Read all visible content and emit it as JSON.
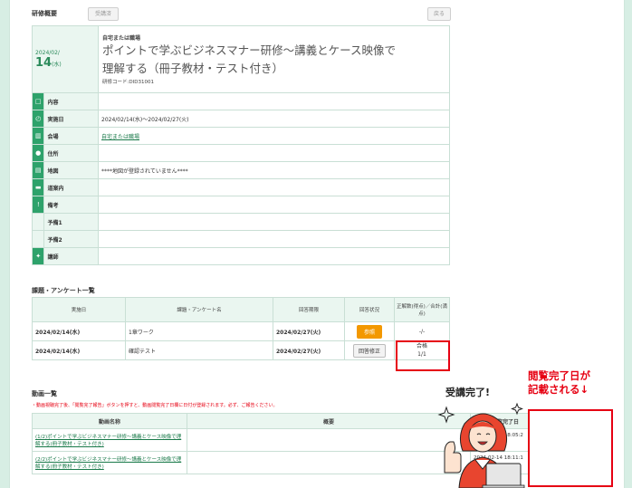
{
  "header": {
    "title": "研修概要",
    "apply_label": "受講済",
    "back_label": "戻る"
  },
  "course": {
    "year_month": "2024/02/",
    "day": "14",
    "weekday": "(水)",
    "place_type": "自宅または職場",
    "title_line1": "ポイントで学ぶビジネスマナー研修～講義とケース映像で",
    "title_line2": "理解する（冊子教材・テスト付き）",
    "code": "研修コード:DID31001"
  },
  "rows": [
    {
      "icon": "□",
      "icon_name": "monitor-icon",
      "label": "内容",
      "value": "",
      "link": false
    },
    {
      "icon": "◴",
      "icon_name": "clock-icon",
      "label": "実施日",
      "value": "2024/02/14(水)～2024/02/27(火)",
      "link": false
    },
    {
      "icon": "▥",
      "icon_name": "building-icon",
      "label": "会場",
      "value": "自宅または職場",
      "link": true
    },
    {
      "icon": "●",
      "icon_name": "map-pin-icon",
      "label": "住所",
      "value": "",
      "link": false
    },
    {
      "icon": "▤",
      "icon_name": "map-icon",
      "label": "地図",
      "value": "****地図が登録されていません****",
      "link": false
    },
    {
      "icon": "▬",
      "icon_name": "speech-bubble-icon",
      "label": "道案内",
      "value": "",
      "link": false
    },
    {
      "icon": "!",
      "icon_name": "exclamation-icon",
      "label": "備考",
      "value": "",
      "link": false
    },
    {
      "icon": "",
      "icon_name": "",
      "label": "予備1",
      "value": "",
      "link": false
    },
    {
      "icon": "",
      "icon_name": "",
      "label": "予備2",
      "value": "",
      "link": false
    },
    {
      "icon": "✦",
      "icon_name": "sparkle-icon",
      "label": "講師",
      "value": "",
      "link": false
    }
  ],
  "tasks": {
    "section_title": "課題・アンケート一覧",
    "headers": [
      "実施日",
      "課題・アンケート名",
      "回答期限",
      "回答状況",
      "正解数(得点)／合計(満点)"
    ],
    "items": [
      {
        "date": "2024/02/14(水)",
        "name": "1章ワーク",
        "deadline": "2024/02/27(火)",
        "action": "参照",
        "score_line1": "-/-",
        "score_line2": ""
      },
      {
        "date": "2024/02/14(水)",
        "name": "確認テスト",
        "deadline": "2024/02/27(火)",
        "action": "回答修正",
        "score_line1": "合格",
        "score_line2": "1/1"
      }
    ]
  },
  "videos": {
    "section_title": "動画一覧",
    "notice": "・動画視聴完了後、「閲覧完了報告」ボタンを押すと、動画閲覧完了日欄に日付が登録されます。必ず、ご報告ください。",
    "headers": [
      "動画名称",
      "概要",
      "動画閲覧完了日"
    ],
    "items": [
      {
        "name": "(1/2)ポイントで学ぶビジネスマナー研修～講義とケース映像で理解する(冊子教材・テスト付き)",
        "summary": "",
        "completed_line1": "2024-02-14 18:05:2",
        "completed_line2": "7"
      },
      {
        "name": "(2/2)ポイントで学ぶビジネスマナー研修～講義とケース映像で理解する(冊子教材・テスト付き)",
        "summary": "",
        "completed_line1": "2024-02-14 18:11:1",
        "completed_line2": "3"
      }
    ]
  },
  "annotation": {
    "bubble": "受講完了!",
    "line1": "閲覧完了日が",
    "line2": "記載される↓"
  },
  "colors": {
    "accent": "#2ea26b",
    "highlight": "#e60012",
    "button_orange": "#f39800"
  }
}
